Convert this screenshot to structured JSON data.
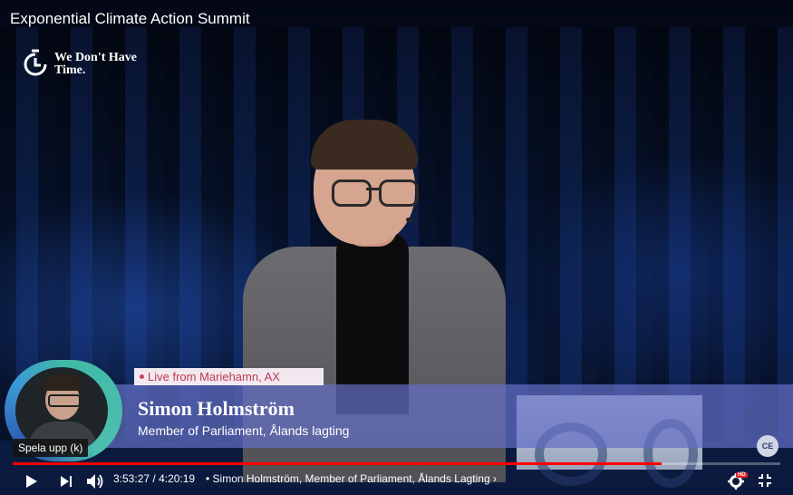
{
  "video": {
    "title": "Exponential Climate Action Summit",
    "brand_logo": "We Don't Have Time.",
    "progress_fraction": 0.8456
  },
  "lower_third": {
    "live_tag": "Live from Mariehamn, AX",
    "name": "Simon Holmström",
    "role": "Member of Parliament, Ålands lagting"
  },
  "preview": {
    "label": "Spela upp (k)"
  },
  "controls": {
    "current_time": "3:53:27",
    "duration": "4:20:19",
    "time_separator": " / ",
    "chapter": "• Simon Holmström, Member of Parliament, Ålands Lagting ›",
    "quality_badge": "HD",
    "icons": [
      "play-icon",
      "next-icon",
      "volume-icon",
      "settings-icon",
      "exit-fullscreen-icon"
    ]
  },
  "colors": {
    "progress_played": "#ff0000",
    "lower_third_bg": "#626ec4",
    "live_text": "#c03a55"
  }
}
